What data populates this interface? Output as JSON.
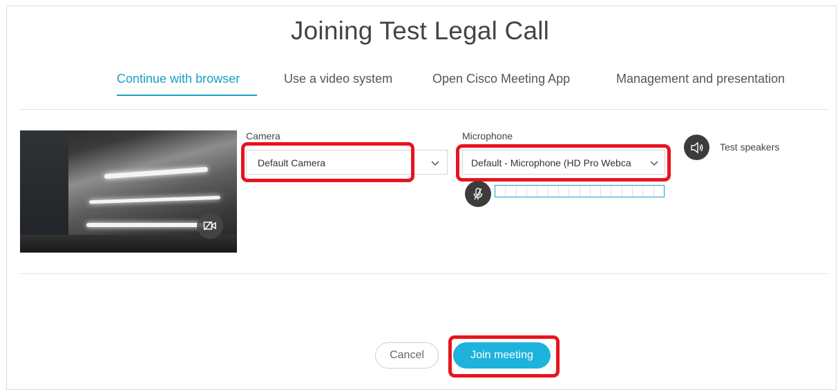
{
  "page": {
    "title": "Joining Test Legal Call"
  },
  "tabs": [
    {
      "label": "Continue with browser",
      "active": true
    },
    {
      "label": "Use a video system",
      "active": false
    },
    {
      "label": "Open Cisco Meeting App",
      "active": false
    },
    {
      "label": "Management and presentation",
      "active": false
    }
  ],
  "camera": {
    "label": "Camera",
    "selected": "Default Camera"
  },
  "microphone": {
    "label": "Microphone",
    "selected": "Default - Microphone (HD Pro Webca"
  },
  "speakers": {
    "label": "Test speakers"
  },
  "actions": {
    "cancel_label": "Cancel",
    "join_label": "Join meeting"
  },
  "colors": {
    "accent": "#1aa0c8",
    "join_button": "#1eb3dc",
    "highlight": "#e8141e"
  },
  "icons": {
    "camera_toggle": "camera-off-icon",
    "mic": "mic-muted-icon",
    "speaker": "speaker-icon",
    "chevron": "chevron-down-icon"
  }
}
